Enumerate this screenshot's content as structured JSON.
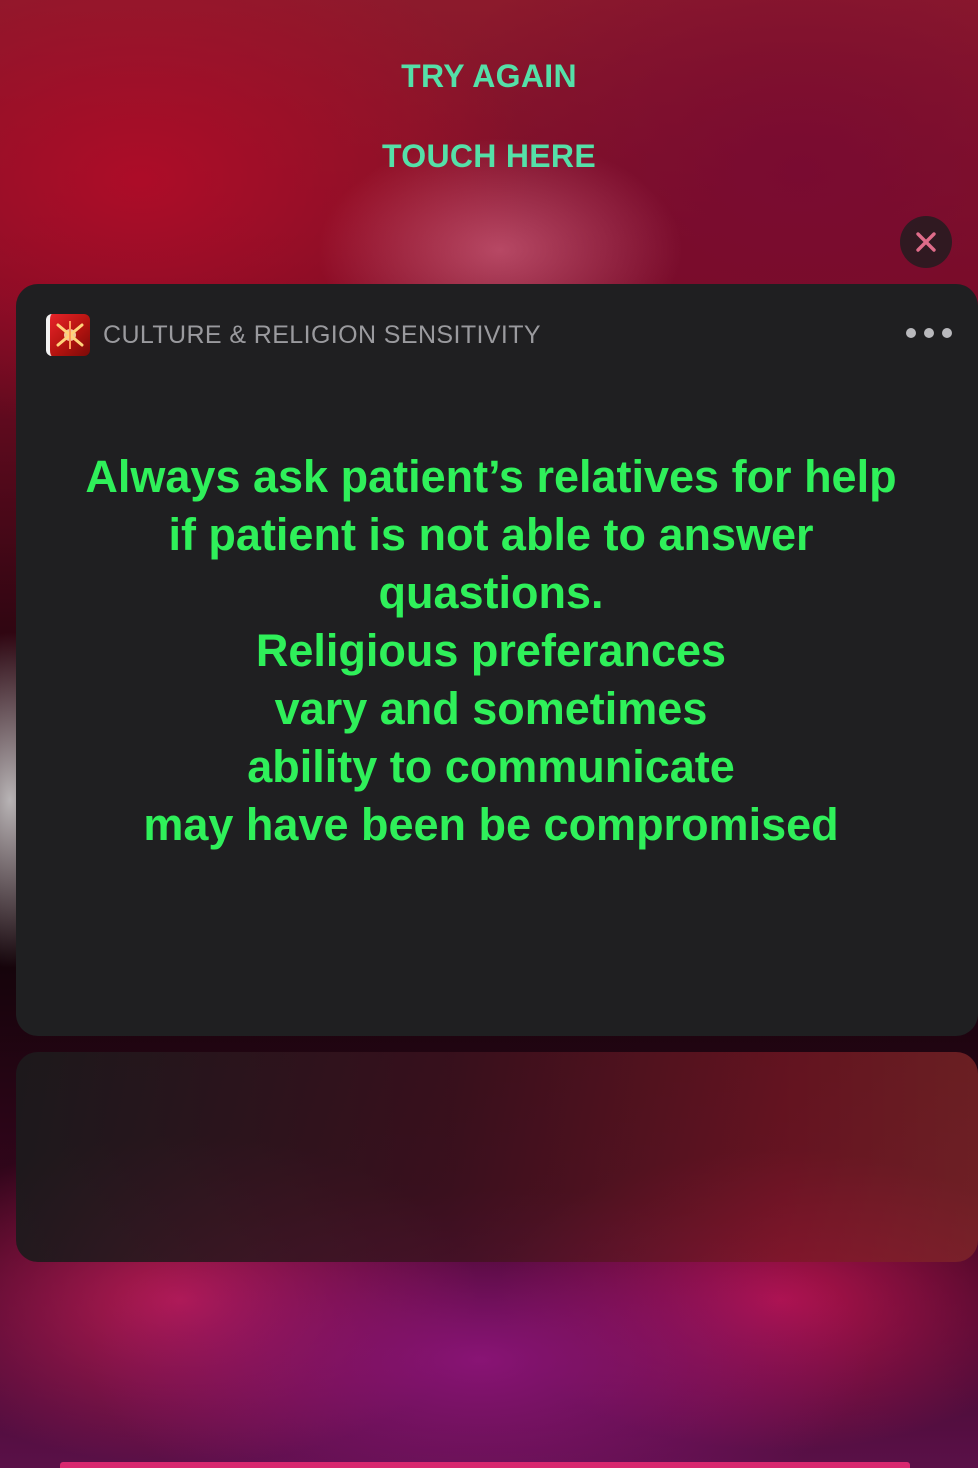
{
  "top_actions": {
    "try_again": "TRY AGAIN",
    "touch_here": "TOUCH HERE"
  },
  "notification": {
    "app_icon": "app-logo-icon",
    "app_name": "CULTURE & RELIGION SENSITIVITY",
    "more_icon": "ellipsis-icon",
    "close_icon": "close-icon",
    "message_lines": [
      "Always ask patient’s relatives for help",
      "if patient is not able to answer",
      "quastions.",
      "Religious preferances",
      "vary and sometimes",
      "ability to communicate",
      "may have been be compromised"
    ]
  },
  "colors": {
    "action_text": "#55e0a8",
    "message_text": "#2ff05a",
    "card_background": "#1f1f21",
    "close_x": "#e06c8a"
  }
}
